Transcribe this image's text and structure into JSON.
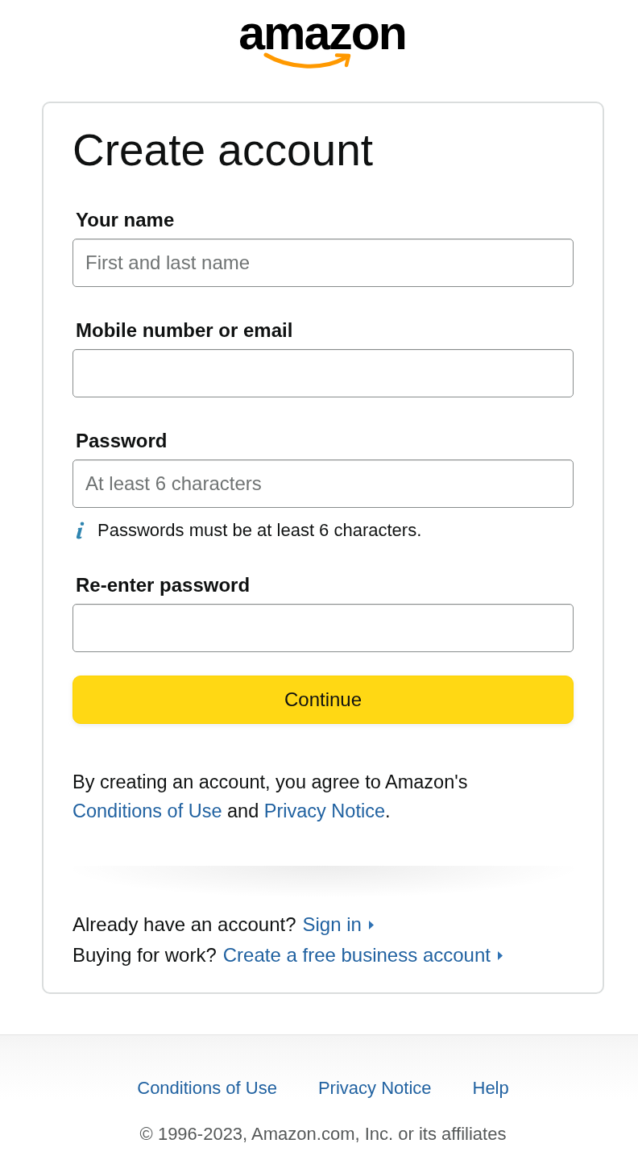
{
  "logo": {
    "wordmark": "amazon"
  },
  "form": {
    "title": "Create account",
    "fields": [
      {
        "label": "Your name",
        "placeholder": "First and last name"
      },
      {
        "label": "Mobile number or email"
      },
      {
        "label": "Password",
        "placeholder": "At least 6 characters",
        "hint": "Passwords must be at least 6 characters."
      },
      {
        "label": "Re-enter password"
      }
    ],
    "submit_button": "Continue",
    "agreement": [
      {
        "kind": "text",
        "text": "By creating an account, you agree to Amazon's "
      },
      {
        "kind": "link",
        "text": "Conditions of Use"
      },
      {
        "kind": "text",
        "text": " and "
      },
      {
        "kind": "link",
        "text": "Privacy Notice"
      },
      {
        "kind": "text",
        "text": "."
      }
    ],
    "prompts": [
      {
        "question": "Already have an account?",
        "link": "Sign in"
      },
      {
        "question": "Buying for work?",
        "link": "Create a free business account"
      }
    ]
  },
  "footer": {
    "links": [
      "Conditions of Use",
      "Privacy Notice",
      "Help"
    ],
    "copyright": "© 1996-2023, Amazon.com, Inc. or its affiliates"
  }
}
